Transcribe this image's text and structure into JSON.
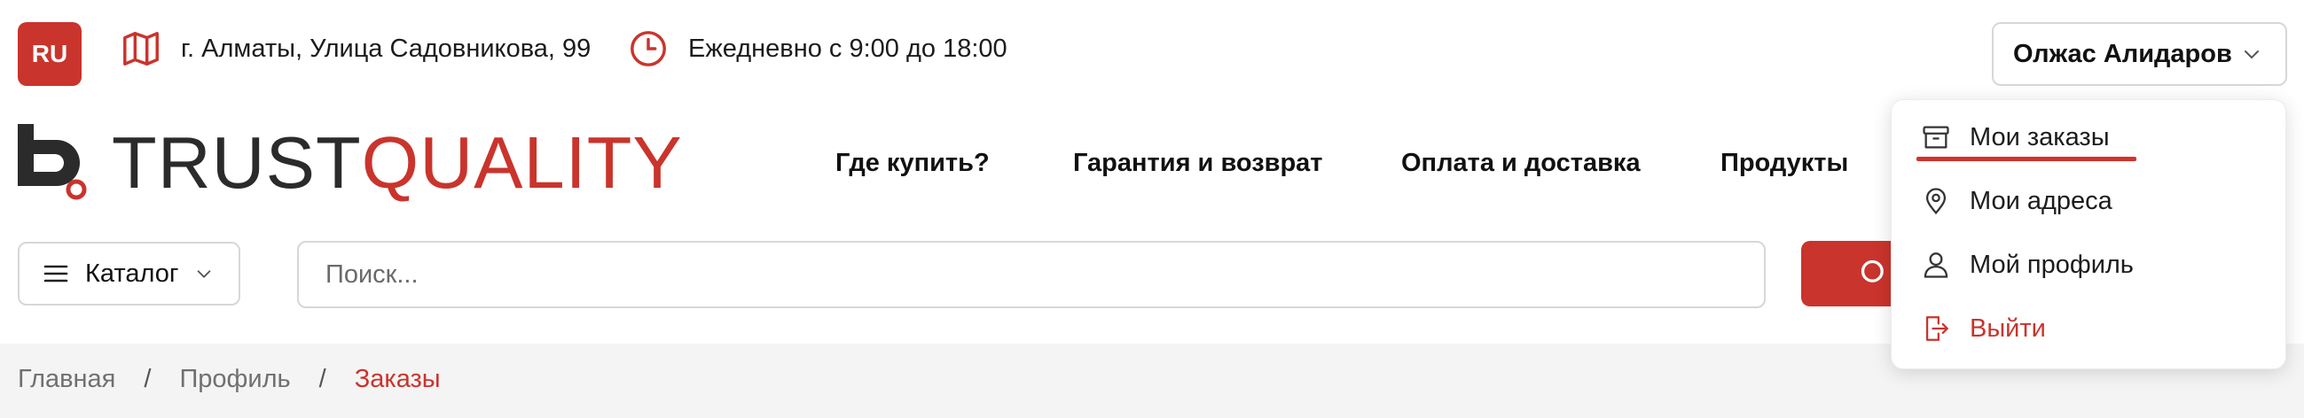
{
  "topbar": {
    "lang": "RU",
    "address": "г. Алматы, Улица Садовникова, 99",
    "hours": "Ежедневно с 9:00 до 18:00",
    "user_name": "Олжас Алидаров"
  },
  "logo": {
    "part1": "TRUST",
    "part2": "QUALITY"
  },
  "nav": {
    "items": [
      "Где купить?",
      "Гарантия и возврат",
      "Оплата и доставка",
      "Продукты"
    ]
  },
  "search": {
    "catalog_label": "Каталог",
    "placeholder": "Поиск..."
  },
  "breadcrumb": {
    "items": [
      "Главная",
      "Профиль",
      "Заказы"
    ],
    "separator": "/"
  },
  "user_menu": {
    "items": [
      "Мои заказы",
      "Мои адреса",
      "Мой профиль",
      "Выйти"
    ]
  },
  "colors": {
    "accent": "#c9342c",
    "text": "#1c1c1c",
    "muted": "#707070"
  }
}
